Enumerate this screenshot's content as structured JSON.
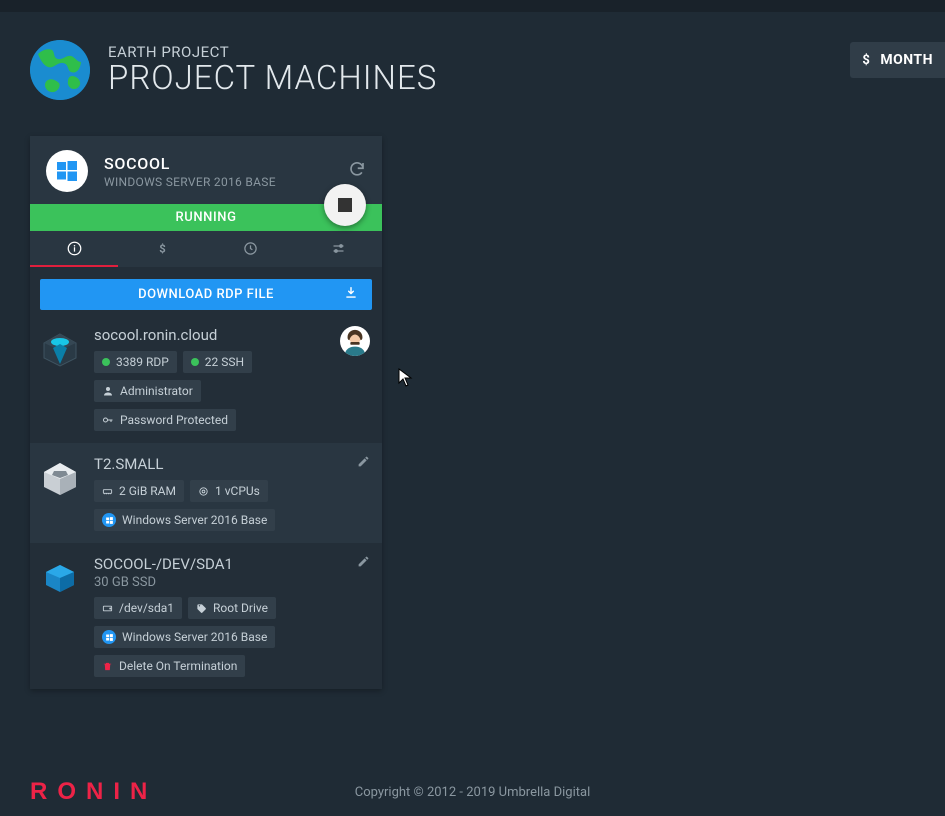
{
  "header": {
    "subtitle": "EARTH PROJECT",
    "title": "PROJECT MACHINES",
    "cost_button": "MONTH"
  },
  "machine": {
    "name": "SOCOOL",
    "os": "WINDOWS SERVER 2016 BASE",
    "status": "RUNNING",
    "rdp_button": "DOWNLOAD RDP FILE",
    "hostname": "socool.ronin.cloud",
    "port_rdp": "3389 RDP",
    "port_ssh": "22 SSH",
    "user": "Administrator",
    "auth": "Password Protected",
    "instance_type": "T2.SMALL",
    "ram": "2 GiB RAM",
    "vcpu": "1 vCPUs",
    "os_label": "Windows Server 2016 Base",
    "volume_name": "SOCOOL-/DEV/SDA1",
    "volume_desc": "30 GB SSD",
    "volume_mount": "/dev/sda1",
    "volume_role": "Root Drive",
    "volume_os": "Windows Server 2016 Base",
    "volume_dot": "Delete On Termination"
  },
  "footer": {
    "copyright": "Copyright © 2012 - 2019 Umbrella Digital",
    "brand": "RONIN"
  }
}
